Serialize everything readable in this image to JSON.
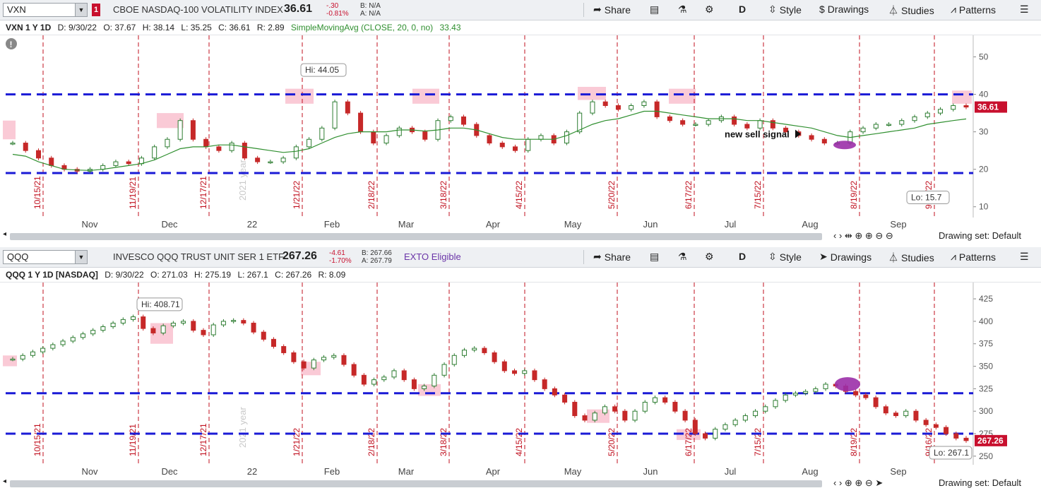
{
  "top": {
    "symbol": "VXN",
    "description": "CBOE NASDAQ-100 VOLATILITY INDEX",
    "last": "36.61",
    "change": "-.30",
    "change_pct": "-0.81%",
    "bid": "B: N/A",
    "ask": "A: N/A",
    "toolbar": {
      "share": "Share",
      "period": "D",
      "style": "Style",
      "drawings": "Drawings",
      "studies": "Studies",
      "patterns": "Patterns"
    },
    "info": {
      "name": "VXN 1 Y 1D",
      "date": "D: 9/30/22",
      "open": "O: 37.67",
      "high": "H: 38.14",
      "low": "L: 35.25",
      "close": "C: 36.61",
      "range": "R: 2.89",
      "sma": "SimpleMovingAvg (CLOSE, 20, 0, no)",
      "sma_val": "33.43"
    },
    "price_label": "36.61",
    "hi_label": "Hi: 44.05",
    "lo_label": "Lo: 15.7",
    "annotation": "new sell signal",
    "drawing_set": "Drawing set: Default",
    "watermark": "2021 year"
  },
  "bottom": {
    "symbol": "QQQ",
    "description": "INVESCO QQQ TRUST UNIT SER 1 ETF",
    "last": "267.26",
    "change": "-4.61",
    "change_pct": "-1.70%",
    "bid": "B: 267.66",
    "ask": "A: 267.79",
    "exto": "EXTO Eligible",
    "toolbar": {
      "share": "Share",
      "period": "D",
      "style": "Style",
      "drawings": "Drawings",
      "studies": "Studies",
      "patterns": "Patterns"
    },
    "info": {
      "name": "QQQ 1 Y 1D [NASDAQ]",
      "date": "D: 9/30/22",
      "open": "O: 271.03",
      "high": "H: 275.19",
      "low": "L: 267.1",
      "close": "C: 267.26",
      "range": "R: 8.09"
    },
    "price_label": "267.26",
    "hi_label": "Hi: 408.71",
    "lo_label": "Lo: 267.1",
    "drawing_set": "Drawing set: Default",
    "watermark": "2021 year"
  },
  "colors": {
    "up": "#2e7d32",
    "down": "#c62828",
    "hline": "#1a1ad6",
    "vline": "#c0101f",
    "sma": "#2f8f2f",
    "highlight": "#f8b8c8",
    "signal": "#9b2fa8",
    "price_tag": "#c8102e"
  },
  "chart_data": [
    {
      "type": "line",
      "title": "VXN 1 Y 1D",
      "x_month_labels": [
        "Nov",
        "Dec",
        "22",
        "Feb",
        "Mar",
        "Apr",
        "May",
        "Jun",
        "Jul",
        "Aug",
        "Sep"
      ],
      "date_markers": [
        "10/15/21",
        "11/19/21",
        "12/17/21",
        "1/21/22",
        "2/18/22",
        "3/18/22",
        "4/15/22",
        "5/20/22",
        "6/17/22",
        "7/15/22",
        "8/19/22",
        "9/16/22"
      ],
      "y_ticks": [
        10,
        20,
        30,
        40,
        50
      ],
      "ylim": [
        7.5,
        55
      ],
      "horizontal_levels": [
        40,
        19
      ],
      "series": [
        {
          "name": "VXN close",
          "values": [
            27,
            25,
            23,
            21,
            20,
            19.5,
            20,
            21,
            22,
            21.5,
            23,
            26,
            28,
            33,
            28,
            26,
            25,
            27,
            23,
            22,
            22,
            23,
            26,
            28,
            31,
            38,
            35,
            30,
            27,
            29,
            31,
            30,
            28,
            33,
            34,
            32,
            29,
            27,
            26,
            25,
            28,
            29,
            27,
            30,
            35,
            38,
            37,
            36,
            37,
            38,
            34,
            33,
            32,
            32,
            33,
            34,
            32,
            31,
            33,
            31,
            30,
            29,
            28,
            27,
            27,
            30,
            31,
            32,
            32,
            33,
            34,
            35,
            36,
            37,
            36.61
          ]
        },
        {
          "name": "SimpleMovingAvg (CLOSE, 20, 0, no)",
          "values": [
            24,
            23.5,
            22,
            21,
            20,
            19.8,
            19.7,
            20,
            20.5,
            21,
            21.5,
            22.5,
            24,
            25.5,
            26,
            26,
            26.5,
            26.5,
            26,
            25.5,
            25,
            24.5,
            24.8,
            25.5,
            27,
            28.5,
            29.5,
            30,
            30,
            30,
            30.5,
            30.5,
            30.2,
            30.5,
            31,
            31,
            30.5,
            29.5,
            28.5,
            28,
            28,
            28,
            28,
            29,
            30.5,
            32,
            33,
            33.5,
            34.5,
            35.5,
            35.5,
            35,
            34.5,
            34,
            33.5,
            33.5,
            33.5,
            33,
            33,
            32.5,
            32,
            31.5,
            31,
            30,
            29,
            28.5,
            29,
            29.5,
            30,
            30.5,
            31,
            32,
            32.5,
            33,
            33.43
          ]
        }
      ],
      "last": 36.61,
      "hi": 44.05,
      "lo": 15.7
    },
    {
      "type": "line",
      "title": "QQQ 1 Y 1D [NASDAQ]",
      "x_month_labels": [
        "Nov",
        "Dec",
        "22",
        "Feb",
        "Mar",
        "Apr",
        "May",
        "Jun",
        "Jul",
        "Aug",
        "Sep"
      ],
      "date_markers": [
        "10/15/21",
        "11/19/21",
        "12/17/21",
        "1/21/22",
        "2/18/22",
        "3/18/22",
        "4/15/22",
        "5/20/22",
        "6/17/22",
        "7/15/22",
        "8/19/22",
        "9/16/22"
      ],
      "y_ticks": [
        250,
        275,
        300,
        325,
        350,
        375,
        400,
        425
      ],
      "ylim": [
        242,
        440
      ],
      "horizontal_levels": [
        320,
        275
      ],
      "series": [
        {
          "name": "QQQ close",
          "values": [
            358,
            362,
            366,
            370,
            374,
            378,
            382,
            386,
            390,
            394,
            398,
            402,
            405,
            392,
            387,
            395,
            398,
            400,
            390,
            385,
            396,
            400,
            401,
            398,
            388,
            380,
            372,
            365,
            355,
            348,
            357,
            360,
            362,
            352,
            340,
            330,
            335,
            338,
            345,
            335,
            325,
            328,
            340,
            352,
            362,
            368,
            370,
            365,
            355,
            345,
            342,
            345,
            335,
            325,
            318,
            310,
            295,
            290,
            298,
            305,
            300,
            290,
            300,
            310,
            315,
            310,
            300,
            290,
            275,
            270,
            280,
            285,
            290,
            295,
            300,
            305,
            312,
            318,
            320,
            322,
            325,
            330,
            328,
            322,
            318,
            315,
            305,
            298,
            295,
            300,
            290,
            285,
            282,
            275,
            270,
            267.26
          ]
        }
      ],
      "last": 267.26,
      "hi": 408.71,
      "lo": 267.1
    }
  ]
}
